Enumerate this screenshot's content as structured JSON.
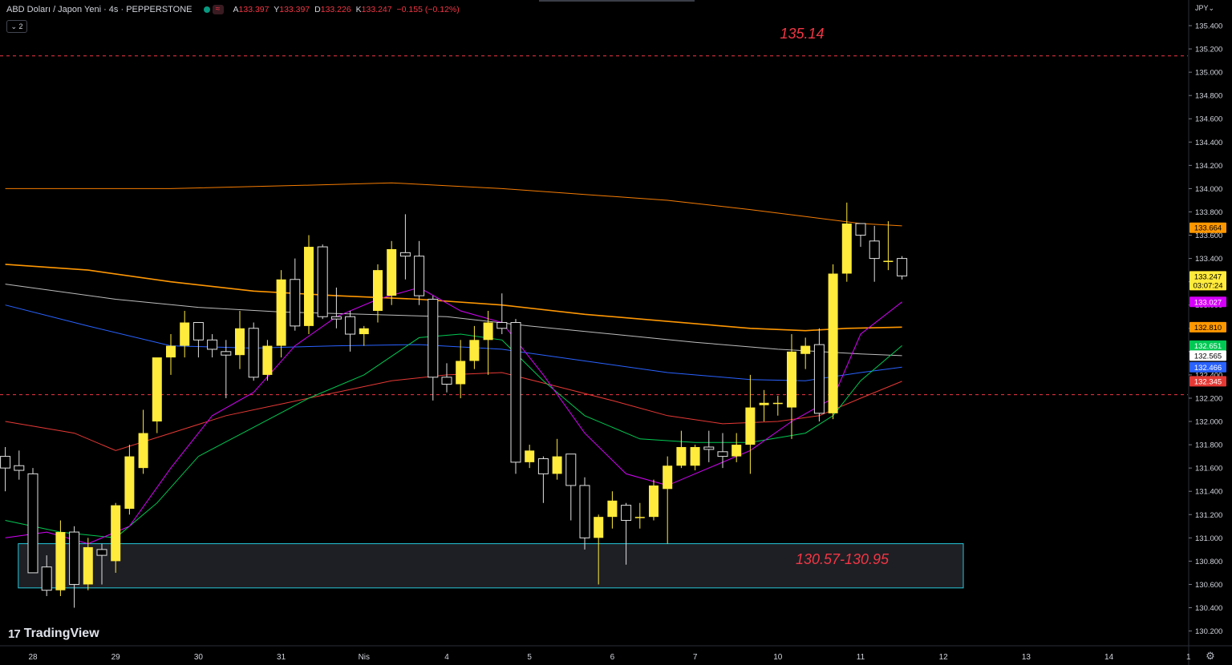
{
  "header": {
    "symbol_title": "ABD Doları / Japon Yeni · 4s · PEPPERSTONE",
    "wave_icon": "≈",
    "ohlc": [
      {
        "label": "A",
        "value": "133.397"
      },
      {
        "label": "Y",
        "value": "133.397"
      },
      {
        "label": "D",
        "value": "133.226"
      },
      {
        "label": "K",
        "value": "133.247"
      }
    ],
    "change": "−0.155 (−0.12%)",
    "indicator_badge": "⌄ 2"
  },
  "axis": {
    "currency": "JPY⌄"
  },
  "logo": {
    "mark": "17",
    "text": "TradingView"
  },
  "colors": {
    "bull": "#ffeb3b",
    "bear_outline": "#e0e0e0",
    "ema_orange_thin": "#f57c00",
    "ema_orange": "#ff9800",
    "sma_white": "#bdbdbd",
    "ema_blue": "#2962ff",
    "ema_red": "#e53935",
    "ema_green": "#00c853",
    "ema_magenta": "#d500f9",
    "annotation_red": "#f23645",
    "zone_border": "#26c6da"
  },
  "chart_data": {
    "type": "candlestick",
    "y_ticks": [
      "135.400",
      "135.200",
      "135.000",
      "134.800",
      "134.600",
      "134.400",
      "134.200",
      "134.000",
      "133.800",
      "133.600",
      "133.400",
      "133.200",
      "133.000",
      "132.800",
      "132.600",
      "132.400",
      "132.200",
      "132.000",
      "131.800",
      "131.600",
      "131.400",
      "131.200",
      "131.000",
      "130.800",
      "130.600",
      "130.400",
      "130.200"
    ],
    "ylim": [
      130.05,
      135.6
    ],
    "x_labels": [
      {
        "label": "28",
        "t": 0
      },
      {
        "label": "29",
        "t": 6
      },
      {
        "label": "30",
        "t": 12
      },
      {
        "label": "31",
        "t": 18
      },
      {
        "label": "Nis",
        "t": 24
      },
      {
        "label": "4",
        "t": 30
      },
      {
        "label": "5",
        "t": 36
      },
      {
        "label": "6",
        "t": 42
      },
      {
        "label": "7",
        "t": 48
      },
      {
        "label": "10",
        "t": 54
      },
      {
        "label": "11",
        "t": 60
      },
      {
        "label": "12",
        "t": 66
      },
      {
        "label": "13",
        "t": 72
      },
      {
        "label": "14",
        "t": 78
      },
      {
        "label": "1",
        "t": 84
      }
    ],
    "candles": [
      {
        "t": -2,
        "o": 131.7,
        "h": 131.78,
        "l": 131.4,
        "c": 131.6
      },
      {
        "t": -1,
        "o": 131.62,
        "h": 131.75,
        "l": 131.5,
        "c": 131.58
      },
      {
        "t": 0,
        "o": 131.55,
        "h": 131.6,
        "l": 130.75,
        "c": 130.7
      },
      {
        "t": 1,
        "o": 130.75,
        "h": 130.85,
        "l": 130.5,
        "c": 130.55
      },
      {
        "t": 2,
        "o": 130.55,
        "h": 131.15,
        "l": 130.5,
        "c": 131.05
      },
      {
        "t": 3,
        "o": 131.05,
        "h": 131.1,
        "l": 130.4,
        "c": 130.6
      },
      {
        "t": 4,
        "o": 130.6,
        "h": 131.0,
        "l": 130.55,
        "c": 130.92
      },
      {
        "t": 5,
        "o": 130.9,
        "h": 130.95,
        "l": 130.6,
        "c": 130.85
      },
      {
        "t": 6,
        "o": 130.8,
        "h": 131.3,
        "l": 130.7,
        "c": 131.28
      },
      {
        "t": 7,
        "o": 131.25,
        "h": 131.8,
        "l": 131.2,
        "c": 131.7
      },
      {
        "t": 8,
        "o": 131.6,
        "h": 132.1,
        "l": 131.55,
        "c": 131.9
      },
      {
        "t": 9,
        "o": 132.0,
        "h": 132.5,
        "l": 131.9,
        "c": 132.55
      },
      {
        "t": 10,
        "o": 132.55,
        "h": 132.75,
        "l": 132.4,
        "c": 132.65
      },
      {
        "t": 11,
        "o": 132.65,
        "h": 132.95,
        "l": 132.55,
        "c": 132.85
      },
      {
        "t": 12,
        "o": 132.85,
        "h": 132.85,
        "l": 132.55,
        "c": 132.7
      },
      {
        "t": 13,
        "o": 132.7,
        "h": 132.75,
        "l": 132.55,
        "c": 132.62
      },
      {
        "t": 14,
        "o": 132.6,
        "h": 132.7,
        "l": 132.2,
        "c": 132.57
      },
      {
        "t": 15,
        "o": 132.57,
        "h": 132.95,
        "l": 132.45,
        "c": 132.8
      },
      {
        "t": 16,
        "o": 132.8,
        "h": 132.85,
        "l": 132.35,
        "c": 132.38
      },
      {
        "t": 17,
        "o": 132.4,
        "h": 132.7,
        "l": 132.35,
        "c": 132.65
      },
      {
        "t": 18,
        "o": 132.65,
        "h": 133.3,
        "l": 132.55,
        "c": 133.22
      },
      {
        "t": 19,
        "o": 133.22,
        "h": 133.4,
        "l": 132.78,
        "c": 132.82
      },
      {
        "t": 20,
        "o": 132.82,
        "h": 133.6,
        "l": 132.75,
        "c": 133.5
      },
      {
        "t": 21,
        "o": 133.5,
        "h": 133.52,
        "l": 132.88,
        "c": 132.9
      },
      {
        "t": 22,
        "o": 132.9,
        "h": 133.15,
        "l": 132.8,
        "c": 132.88
      },
      {
        "t": 23,
        "o": 132.9,
        "h": 132.95,
        "l": 132.6,
        "c": 132.75
      },
      {
        "t": 24,
        "o": 132.75,
        "h": 132.82,
        "l": 132.65,
        "c": 132.8
      },
      {
        "t": 25,
        "o": 132.95,
        "h": 133.35,
        "l": 132.85,
        "c": 133.3
      },
      {
        "t": 26,
        "o": 133.08,
        "h": 133.55,
        "l": 133.0,
        "c": 133.48
      },
      {
        "t": 27,
        "o": 133.45,
        "h": 133.78,
        "l": 133.22,
        "c": 133.42
      },
      {
        "t": 28,
        "o": 133.42,
        "h": 133.55,
        "l": 133.0,
        "c": 133.08
      },
      {
        "t": 29,
        "o": 133.05,
        "h": 133.08,
        "l": 132.18,
        "c": 132.38
      },
      {
        "t": 30,
        "o": 132.38,
        "h": 132.5,
        "l": 132.25,
        "c": 132.32
      },
      {
        "t": 31,
        "o": 132.32,
        "h": 132.7,
        "l": 132.2,
        "c": 132.52
      },
      {
        "t": 32,
        "o": 132.52,
        "h": 132.82,
        "l": 132.45,
        "c": 132.7
      },
      {
        "t": 33,
        "o": 132.7,
        "h": 132.95,
        "l": 132.4,
        "c": 132.85
      },
      {
        "t": 34,
        "o": 132.85,
        "h": 133.1,
        "l": 132.75,
        "c": 132.8
      },
      {
        "t": 35,
        "o": 132.85,
        "h": 132.88,
        "l": 131.55,
        "c": 131.65
      },
      {
        "t": 36,
        "o": 131.65,
        "h": 131.8,
        "l": 131.6,
        "c": 131.75
      },
      {
        "t": 37,
        "o": 131.68,
        "h": 131.7,
        "l": 131.3,
        "c": 131.55
      },
      {
        "t": 38,
        "o": 131.55,
        "h": 131.85,
        "l": 131.5,
        "c": 131.7
      },
      {
        "t": 39,
        "o": 131.72,
        "h": 131.72,
        "l": 131.15,
        "c": 131.45
      },
      {
        "t": 40,
        "o": 131.45,
        "h": 131.52,
        "l": 130.9,
        "c": 131.0
      },
      {
        "t": 41,
        "o": 131.0,
        "h": 131.2,
        "l": 130.6,
        "c": 131.18
      },
      {
        "t": 42,
        "o": 131.18,
        "h": 131.4,
        "l": 131.08,
        "c": 131.32
      },
      {
        "t": 43,
        "o": 131.28,
        "h": 131.3,
        "l": 130.77,
        "c": 131.15
      },
      {
        "t": 44,
        "o": 131.18,
        "h": 131.3,
        "l": 131.08,
        "c": 131.18
      },
      {
        "t": 45,
        "o": 131.18,
        "h": 131.5,
        "l": 131.15,
        "c": 131.45
      },
      {
        "t": 46,
        "o": 131.42,
        "h": 131.7,
        "l": 130.95,
        "c": 131.62
      },
      {
        "t": 47,
        "o": 131.62,
        "h": 131.92,
        "l": 131.6,
        "c": 131.78
      },
      {
        "t": 48,
        "o": 131.62,
        "h": 131.8,
        "l": 131.58,
        "c": 131.78
      },
      {
        "t": 49,
        "o": 131.78,
        "h": 131.92,
        "l": 131.65,
        "c": 131.76
      },
      {
        "t": 50,
        "o": 131.74,
        "h": 131.9,
        "l": 131.6,
        "c": 131.7
      },
      {
        "t": 51,
        "o": 131.7,
        "h": 131.9,
        "l": 131.65,
        "c": 131.8
      },
      {
        "t": 52,
        "o": 131.8,
        "h": 132.4,
        "l": 131.55,
        "c": 132.12
      },
      {
        "t": 53,
        "o": 132.14,
        "h": 132.27,
        "l": 132.0,
        "c": 132.16
      },
      {
        "t": 54,
        "o": 132.15,
        "h": 132.22,
        "l": 132.05,
        "c": 132.16
      },
      {
        "t": 55,
        "o": 132.12,
        "h": 132.75,
        "l": 131.85,
        "c": 132.6
      },
      {
        "t": 56,
        "o": 132.58,
        "h": 132.72,
        "l": 132.45,
        "c": 132.65
      },
      {
        "t": 57,
        "o": 132.66,
        "h": 132.8,
        "l": 132.0,
        "c": 132.07
      },
      {
        "t": 58,
        "o": 132.07,
        "h": 133.35,
        "l": 132.02,
        "c": 133.27
      },
      {
        "t": 59,
        "o": 133.27,
        "h": 133.88,
        "l": 133.2,
        "c": 133.7
      },
      {
        "t": 60,
        "o": 133.7,
        "h": 133.7,
        "l": 133.5,
        "c": 133.6
      },
      {
        "t": 61,
        "o": 133.55,
        "h": 133.68,
        "l": 133.2,
        "c": 133.4
      },
      {
        "t": 62,
        "o": 133.38,
        "h": 133.72,
        "l": 133.3,
        "c": 133.38
      },
      {
        "t": 63,
        "o": 133.4,
        "h": 133.42,
        "l": 133.22,
        "c": 133.25
      }
    ],
    "series": [
      {
        "key": "ema_orange_thin",
        "width": 1,
        "points": [
          [
            -2,
            134.0
          ],
          [
            10,
            134.0
          ],
          [
            20,
            134.03
          ],
          [
            26,
            134.05
          ],
          [
            34,
            134.0
          ],
          [
            40,
            133.95
          ],
          [
            46,
            133.9
          ],
          [
            52,
            133.82
          ],
          [
            56,
            133.76
          ],
          [
            60,
            133.7
          ],
          [
            63,
            133.68
          ]
        ]
      },
      {
        "key": "ema_orange",
        "width": 1.6,
        "points": [
          [
            -2,
            133.35
          ],
          [
            4,
            133.3
          ],
          [
            10,
            133.2
          ],
          [
            16,
            133.12
          ],
          [
            22,
            133.08
          ],
          [
            28,
            133.05
          ],
          [
            34,
            133.0
          ],
          [
            40,
            132.92
          ],
          [
            46,
            132.86
          ],
          [
            52,
            132.8
          ],
          [
            56,
            132.78
          ],
          [
            59,
            132.8
          ],
          [
            63,
            132.81
          ]
        ]
      },
      {
        "key": "sma_white",
        "width": 1,
        "points": [
          [
            -2,
            133.18
          ],
          [
            6,
            133.05
          ],
          [
            12,
            132.98
          ],
          [
            18,
            132.94
          ],
          [
            24,
            132.92
          ],
          [
            30,
            132.9
          ],
          [
            36,
            132.82
          ],
          [
            42,
            132.75
          ],
          [
            48,
            132.68
          ],
          [
            54,
            132.62
          ],
          [
            60,
            132.58
          ],
          [
            63,
            132.565
          ]
        ]
      },
      {
        "key": "ema_blue",
        "width": 1,
        "points": [
          [
            -2,
            133.0
          ],
          [
            4,
            132.82
          ],
          [
            10,
            132.65
          ],
          [
            16,
            132.63
          ],
          [
            22,
            132.65
          ],
          [
            28,
            132.66
          ],
          [
            34,
            132.62
          ],
          [
            40,
            132.52
          ],
          [
            46,
            132.42
          ],
          [
            52,
            132.36
          ],
          [
            56,
            132.35
          ],
          [
            60,
            132.42
          ],
          [
            63,
            132.466
          ]
        ]
      },
      {
        "key": "ema_red",
        "width": 1,
        "points": [
          [
            -2,
            132.0
          ],
          [
            3,
            131.9
          ],
          [
            6,
            131.75
          ],
          [
            10,
            131.9
          ],
          [
            14,
            132.05
          ],
          [
            18,
            132.15
          ],
          [
            22,
            132.25
          ],
          [
            26,
            132.35
          ],
          [
            30,
            132.4
          ],
          [
            34,
            132.42
          ],
          [
            38,
            132.3
          ],
          [
            42,
            132.18
          ],
          [
            46,
            132.05
          ],
          [
            50,
            131.98
          ],
          [
            54,
            132.0
          ],
          [
            57,
            132.05
          ],
          [
            60,
            132.2
          ],
          [
            63,
            132.345
          ]
        ]
      },
      {
        "key": "ema_green",
        "width": 1,
        "points": [
          [
            -2,
            131.15
          ],
          [
            2,
            131.05
          ],
          [
            6,
            131.0
          ],
          [
            9,
            131.3
          ],
          [
            12,
            131.7
          ],
          [
            16,
            131.95
          ],
          [
            20,
            132.2
          ],
          [
            24,
            132.4
          ],
          [
            28,
            132.72
          ],
          [
            31,
            132.75
          ],
          [
            34,
            132.7
          ],
          [
            37,
            132.35
          ],
          [
            40,
            132.05
          ],
          [
            44,
            131.85
          ],
          [
            48,
            131.82
          ],
          [
            52,
            131.82
          ],
          [
            56,
            131.9
          ],
          [
            58,
            132.05
          ],
          [
            60,
            132.35
          ],
          [
            63,
            132.651
          ]
        ]
      },
      {
        "key": "ema_magenta",
        "width": 1,
        "points": [
          [
            -2,
            131.0
          ],
          [
            1,
            131.05
          ],
          [
            4,
            130.95
          ],
          [
            7,
            131.1
          ],
          [
            10,
            131.6
          ],
          [
            13,
            132.05
          ],
          [
            16,
            132.25
          ],
          [
            19,
            132.65
          ],
          [
            22,
            132.9
          ],
          [
            25,
            133.05
          ],
          [
            28,
            133.15
          ],
          [
            31,
            132.95
          ],
          [
            34,
            132.85
          ],
          [
            37,
            132.4
          ],
          [
            40,
            131.9
          ],
          [
            43,
            131.55
          ],
          [
            46,
            131.45
          ],
          [
            49,
            131.6
          ],
          [
            52,
            131.75
          ],
          [
            55,
            132.0
          ],
          [
            58,
            132.2
          ],
          [
            60,
            132.75
          ],
          [
            63,
            133.027
          ]
        ]
      }
    ],
    "hlines": [
      {
        "price": 135.14,
        "color": "#f23645",
        "dash": "4,4"
      },
      {
        "price": 132.23,
        "color": "#f23645",
        "dash": "4,4"
      }
    ],
    "zone": {
      "from_t": -1,
      "to_t": 67.5,
      "low": 130.57,
      "high": 130.95,
      "label": "130.57-130.95"
    },
    "level_label": "135.14",
    "price_tags": [
      {
        "value": "133.664",
        "price": 133.664,
        "bg": "#ff9800",
        "fg": "#000000"
      },
      {
        "value": "133.247",
        "price": 133.247,
        "bg": "#ffeb3b",
        "fg": "#000000",
        "sub": "03:07:24"
      },
      {
        "value": "133.027",
        "price": 133.027,
        "bg": "#d500f9",
        "fg": "#ffffff"
      },
      {
        "value": "132.810",
        "price": 132.81,
        "bg": "#ff9800",
        "fg": "#000000"
      },
      {
        "value": "132.651",
        "price": 132.651,
        "bg": "#00c853",
        "fg": "#ffffff"
      },
      {
        "value": "132.565",
        "price": 132.565,
        "bg": "#ffffff",
        "fg": "#000000"
      },
      {
        "value": "132.466",
        "price": 132.466,
        "bg": "#2962ff",
        "fg": "#ffffff"
      },
      {
        "value": "132.345",
        "price": 132.345,
        "bg": "#e53935",
        "fg": "#ffffff"
      }
    ]
  }
}
